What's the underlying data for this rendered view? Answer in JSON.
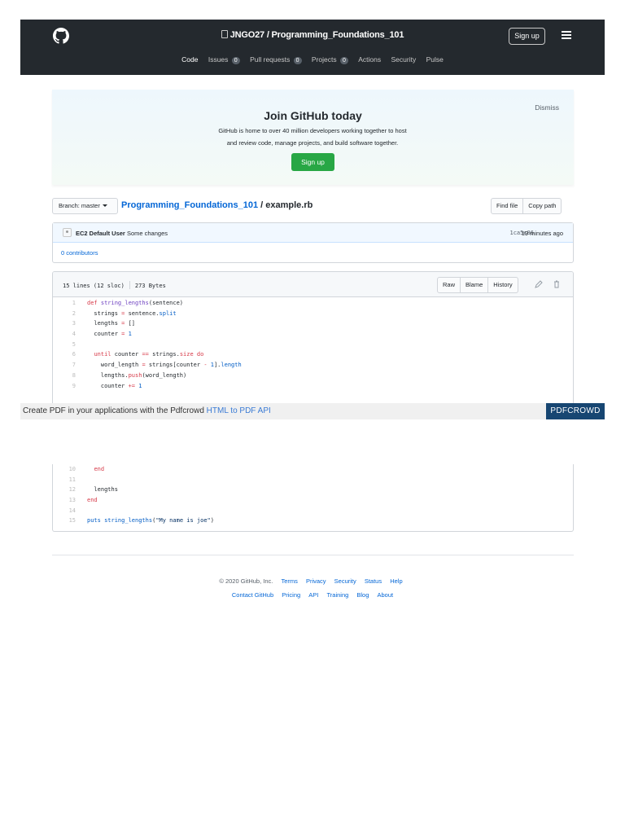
{
  "header": {
    "repo_title": "JNGO27 / Programming_Foundations_101",
    "signup_label": "Sign up",
    "nav": [
      {
        "label": "Code",
        "count": ""
      },
      {
        "label": "Issues",
        "count": "0"
      },
      {
        "label": "Pull requests",
        "count": "0"
      },
      {
        "label": "Projects",
        "count": "0"
      },
      {
        "label": "Actions",
        "count": ""
      },
      {
        "label": "Security",
        "count": ""
      },
      {
        "label": "Pulse",
        "count": ""
      }
    ]
  },
  "banner": {
    "title": "Join GitHub today",
    "line1": "GitHub is home to over 40 million developers working together to host",
    "line2": "and review code, manage projects, and build software together.",
    "button": "Sign up",
    "dismiss": "Dismiss"
  },
  "breadcrumb": {
    "branch_label": "Branch: master",
    "repo": "Programming_Foundations_101",
    "separator": " / ",
    "file": "example.rb",
    "find_file": "Find file",
    "copy_path": "Copy path"
  },
  "commit": {
    "author": "EC2 Default User",
    "message": "Some changes",
    "sha": "1ca5c86",
    "time": "19 minutes ago",
    "contributors": "0 contributors"
  },
  "file": {
    "lines_info": "15 lines (12 sloc)",
    "size": "273 Bytes",
    "raw": "Raw",
    "blame": "Blame",
    "history": "History",
    "edit_icon": "pencil-icon",
    "delete_icon": "trash-icon"
  },
  "code_lines": [
    {
      "num": "1",
      "text": "def string_lengths(sentence)"
    },
    {
      "num": "2",
      "text": "  strings = sentence.split"
    },
    {
      "num": "3",
      "text": "  lengths = []"
    },
    {
      "num": "4",
      "text": "  counter = 1"
    },
    {
      "num": "5",
      "text": ""
    },
    {
      "num": "6",
      "text": "  until counter == strings.size do"
    },
    {
      "num": "7",
      "text": "    word_length = strings[counter - 1].length"
    },
    {
      "num": "8",
      "text": "    lengths.push(word_length)"
    },
    {
      "num": "9",
      "text": "    counter += 1"
    },
    {
      "num": "10",
      "text": "  end"
    },
    {
      "num": "11",
      "text": ""
    },
    {
      "num": "12",
      "text": "  lengths"
    },
    {
      "num": "13",
      "text": "end"
    },
    {
      "num": "14",
      "text": ""
    },
    {
      "num": "15",
      "text": "puts string_lengths(\"My name is joe\")"
    }
  ],
  "pdf_bar": {
    "text": "Create PDF in your applications with the Pdfcrowd",
    "link": "HTML to PDF API",
    "brand": "PDFCROWD"
  },
  "footer": {
    "copyright": "© 2020 GitHub, Inc.",
    "row1": [
      "Terms",
      "Privacy",
      "Security",
      "Status",
      "Help"
    ],
    "row2": [
      "Contact GitHub",
      "Pricing",
      "API",
      "Training",
      "Blog",
      "About"
    ]
  }
}
